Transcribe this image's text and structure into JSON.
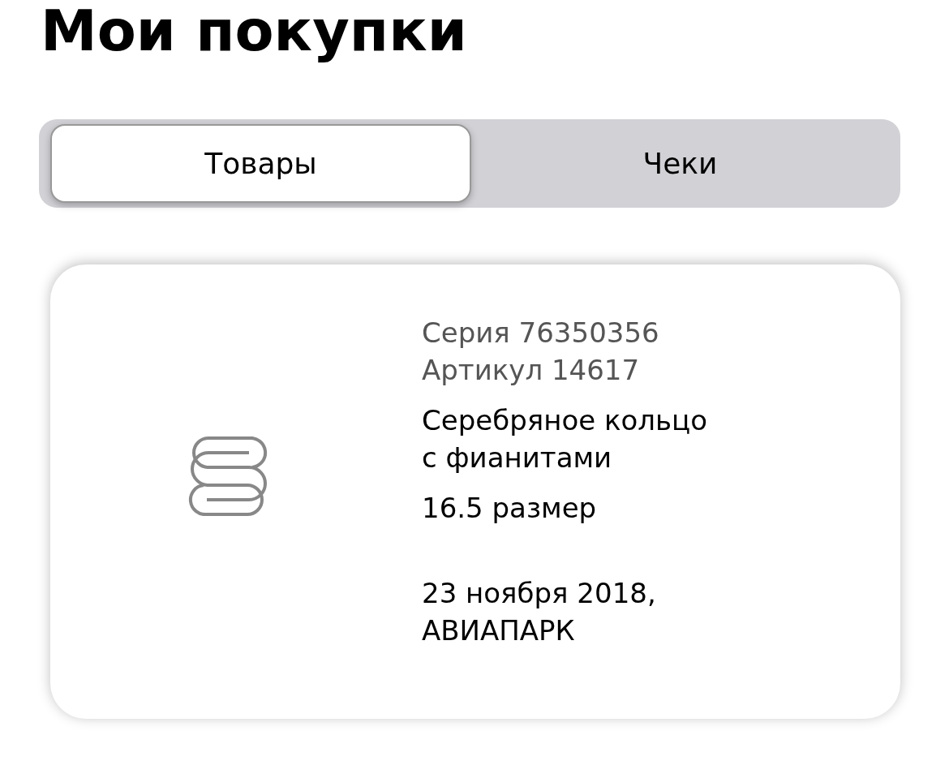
{
  "title": "Мои покупки",
  "tabs": [
    {
      "label": "Товары",
      "selected": true
    },
    {
      "label": "Чеки",
      "selected": false
    }
  ],
  "product": {
    "series": "Серия 76350356",
    "article": "Артикул 14617",
    "name": "Серебряное кольцо с фианитами",
    "size": "16.5 размер",
    "date": "23 ноября 2018,",
    "store": "АВИАПАРК"
  }
}
